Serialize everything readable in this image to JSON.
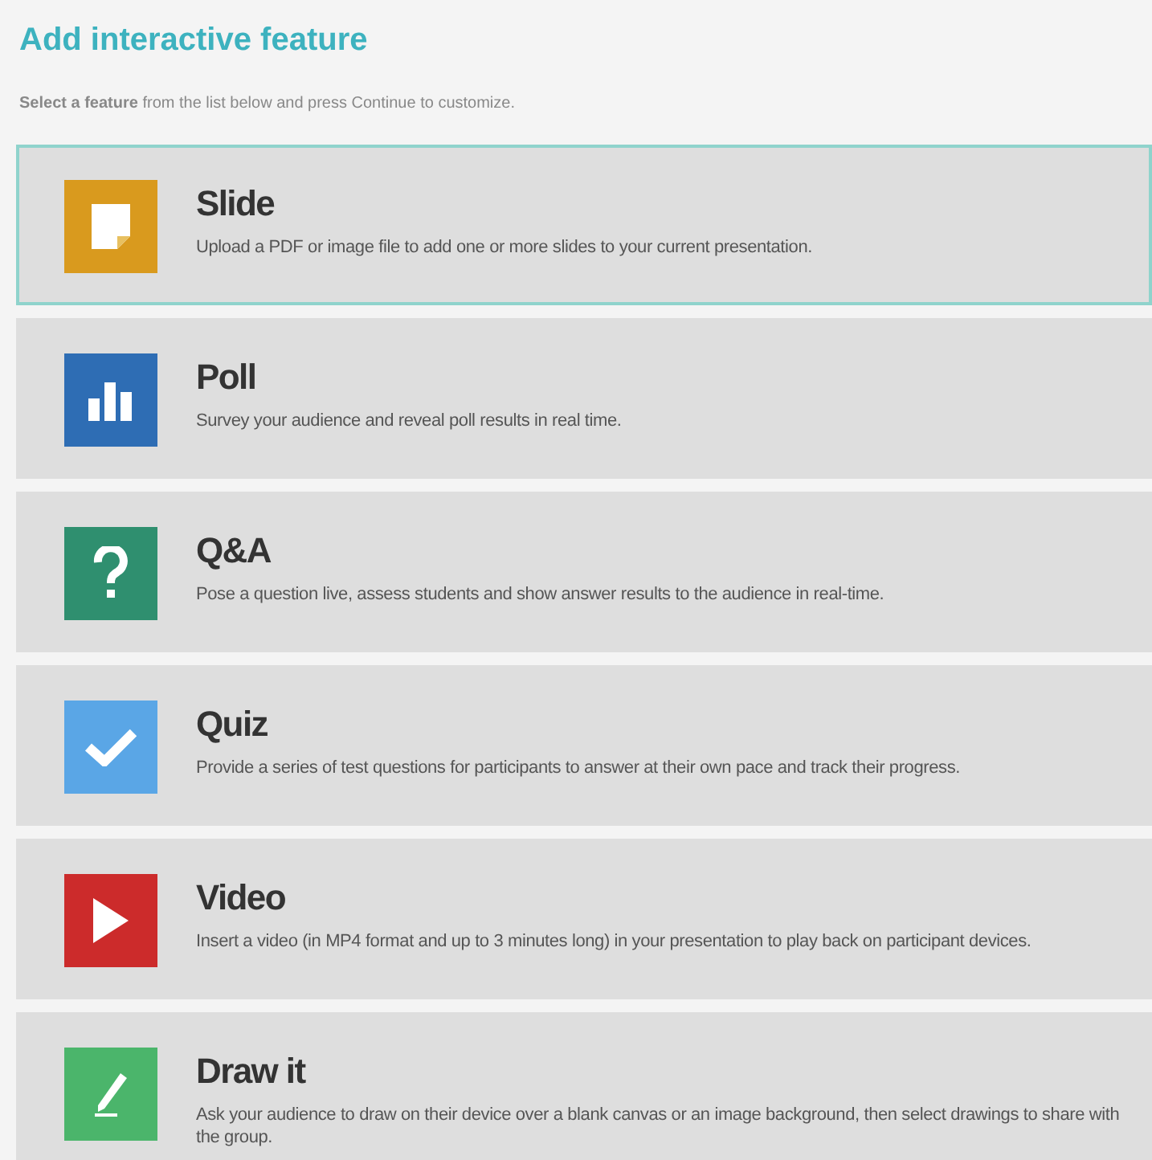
{
  "title": "Add interactive feature",
  "subtitle": "**Select a feature** from the list below and press Continue to customize.",
  "features": [
    {
      "kind": "slide",
      "color": "#d99a1e",
      "title": "Slide",
      "description": "Upload a PDF or image file to add one or more slides to your current presentation.",
      "selected": true
    },
    {
      "kind": "poll",
      "color": "#2e6db4",
      "title": "Poll",
      "description": "Survey your audience and reveal poll results in real time.",
      "selected": false
    },
    {
      "kind": "qa",
      "color": "#2f8f6f",
      "title": "Q&A",
      "description": "Pose a question live, assess students and show answer results to the audience in real-time.",
      "selected": false
    },
    {
      "kind": "quiz",
      "color": "#5aa6e6",
      "title": "Quiz",
      "description": "Provide a series of test questions for participants to answer at their own pace and track their progress.",
      "selected": false
    },
    {
      "kind": "video",
      "color": "#cc2b2b",
      "title": "Video",
      "description": "Insert a video (in MP4 format and up to 3 minutes long) in your presentation to play back on participant devices.",
      "selected": false
    },
    {
      "kind": "draw",
      "color": "#4bb56b",
      "title": "Draw it",
      "description": "Ask your audience to draw on their device over a blank canvas or an image background, then select drawings to share with the group.",
      "selected": false
    }
  ]
}
